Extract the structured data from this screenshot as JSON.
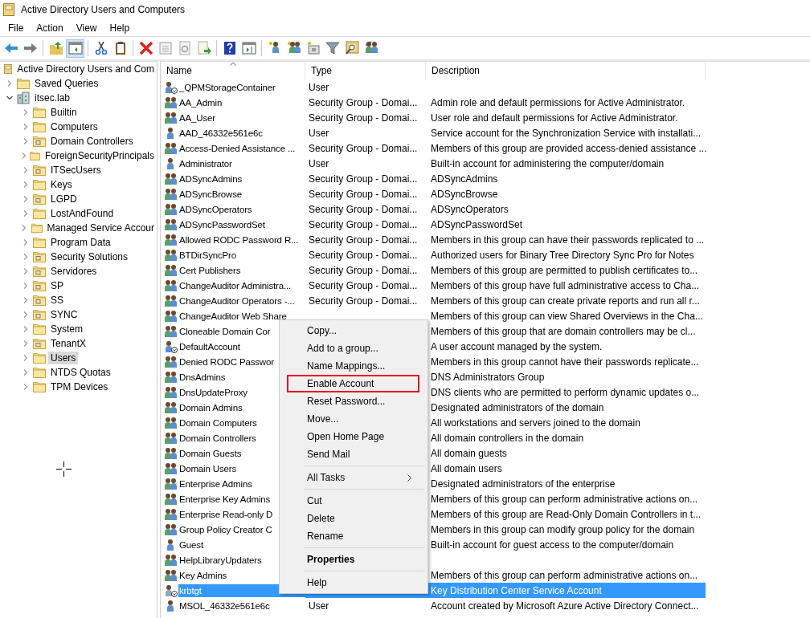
{
  "window": {
    "title": "Active Directory Users and Computers"
  },
  "menu": [
    "File",
    "Action",
    "View",
    "Help"
  ],
  "toolbar": [
    {
      "kind": "back",
      "pressed": false
    },
    {
      "kind": "forward",
      "pressed": false
    },
    {
      "kind": "sep"
    },
    {
      "kind": "up",
      "pressed": false
    },
    {
      "kind": "console-tree",
      "pressed": true
    },
    {
      "kind": "sep"
    },
    {
      "kind": "cut",
      "pressed": false
    },
    {
      "kind": "paste",
      "pressed": false
    },
    {
      "kind": "sep"
    },
    {
      "kind": "delete",
      "pressed": false
    },
    {
      "kind": "properties",
      "pressed": false
    },
    {
      "kind": "refresh",
      "pressed": false
    },
    {
      "kind": "export",
      "pressed": false
    },
    {
      "kind": "sep"
    },
    {
      "kind": "help",
      "pressed": false
    },
    {
      "kind": "action-pane",
      "pressed": false
    },
    {
      "kind": "sep"
    },
    {
      "kind": "new-user",
      "pressed": false
    },
    {
      "kind": "new-group",
      "pressed": false
    },
    {
      "kind": "new-ou",
      "pressed": false
    },
    {
      "kind": "filter",
      "pressed": false
    },
    {
      "kind": "find",
      "pressed": false
    },
    {
      "kind": "add-to-group",
      "pressed": false
    }
  ],
  "tree": {
    "label": "Active Directory Users and Com",
    "kind": "root",
    "children": [
      {
        "label": "Saved Queries",
        "kind": "container",
        "expanded": false,
        "selected": false
      },
      {
        "label": "itsec.lab",
        "kind": "domain",
        "expanded": true,
        "selected": false,
        "children": [
          {
            "label": "Builtin",
            "kind": "container",
            "expanded": false,
            "selected": false
          },
          {
            "label": "Computers",
            "kind": "container",
            "expanded": false,
            "selected": false
          },
          {
            "label": "Domain Controllers",
            "kind": "ou",
            "expanded": false,
            "selected": false
          },
          {
            "label": "ForeignSecurityPrincipals",
            "kind": "container",
            "expanded": false,
            "selected": false
          },
          {
            "label": "ITSecUsers",
            "kind": "ou",
            "expanded": false,
            "selected": false
          },
          {
            "label": "Keys",
            "kind": "container",
            "expanded": false,
            "selected": false
          },
          {
            "label": "LGPD",
            "kind": "ou",
            "expanded": false,
            "selected": false
          },
          {
            "label": "LostAndFound",
            "kind": "container",
            "expanded": false,
            "selected": false
          },
          {
            "label": "Managed Service Accour",
            "kind": "container",
            "expanded": false,
            "selected": false
          },
          {
            "label": "Program Data",
            "kind": "container",
            "expanded": false,
            "selected": false
          },
          {
            "label": "Security Solutions",
            "kind": "ou",
            "expanded": false,
            "selected": false
          },
          {
            "label": "Servidores",
            "kind": "ou",
            "expanded": false,
            "selected": false
          },
          {
            "label": "SP",
            "kind": "ou",
            "expanded": false,
            "selected": false
          },
          {
            "label": "SS",
            "kind": "ou",
            "expanded": false,
            "selected": false
          },
          {
            "label": "SYNC",
            "kind": "ou",
            "expanded": false,
            "selected": false
          },
          {
            "label": "System",
            "kind": "container",
            "expanded": false,
            "selected": false
          },
          {
            "label": "TenantX",
            "kind": "ou",
            "expanded": false,
            "selected": false
          },
          {
            "label": "Users",
            "kind": "container",
            "expanded": false,
            "selected": true
          },
          {
            "label": "NTDS Quotas",
            "kind": "container",
            "expanded": false,
            "selected": false
          },
          {
            "label": "TPM Devices",
            "kind": "container",
            "expanded": false,
            "selected": false
          }
        ]
      }
    ]
  },
  "table": {
    "columns": [
      "Name",
      "Type",
      "Description"
    ],
    "rows": [
      {
        "kind": "disabled-user",
        "name": "_QPMStorageContainer",
        "type": "User",
        "selected": false
      },
      {
        "kind": "group",
        "name": "AA_Admin",
        "type": "Security Group - Domai...",
        "description": "Admin role and default permissions for Active Administrator.",
        "selected": false
      },
      {
        "kind": "group",
        "name": "AA_User",
        "type": "Security Group - Domai...",
        "description": "User role and default permissions for Active Administrator.",
        "selected": false
      },
      {
        "kind": "user",
        "name": "AAD_46332e561e6c",
        "type": "User",
        "description": "Service account for the Synchronization Service with installati...",
        "selected": false
      },
      {
        "kind": "group",
        "name": "Access-Denied Assistance ...",
        "type": "Security Group - Domai...",
        "description": "Members of this group are provided access-denied assistance ...",
        "selected": false
      },
      {
        "kind": "user",
        "name": "Administrator",
        "type": "User",
        "description": "Built-in account for administering the computer/domain",
        "selected": false
      },
      {
        "kind": "group",
        "name": "ADSyncAdmins",
        "type": "Security Group - Domai...",
        "description": "ADSyncAdmins",
        "selected": false
      },
      {
        "kind": "group",
        "name": "ADSyncBrowse",
        "type": "Security Group - Domai...",
        "description": "ADSyncBrowse",
        "selected": false
      },
      {
        "kind": "group",
        "name": "ADSyncOperators",
        "type": "Security Group - Domai...",
        "description": "ADSyncOperators",
        "selected": false
      },
      {
        "kind": "group",
        "name": "ADSyncPasswordSet",
        "type": "Security Group - Domai...",
        "description": "ADSyncPasswordSet",
        "selected": false
      },
      {
        "kind": "group",
        "name": "Allowed RODC Password R...",
        "type": "Security Group - Domai...",
        "description": "Members in this group can have their passwords replicated to ...",
        "selected": false
      },
      {
        "kind": "group",
        "name": "BTDirSyncPro",
        "type": "Security Group - Domai...",
        "description": "Authorized users for Binary Tree Directory Sync Pro for Notes",
        "selected": false
      },
      {
        "kind": "group",
        "name": "Cert Publishers",
        "type": "Security Group - Domai...",
        "description": "Members of this group are permitted to publish certificates to...",
        "selected": false
      },
      {
        "kind": "group",
        "name": "ChangeAuditor Administra...",
        "type": "Security Group - Domai...",
        "description": "Members of this group have full administrative access to Cha...",
        "selected": false
      },
      {
        "kind": "group",
        "name": "ChangeAuditor Operators -...",
        "type": "Security Group - Domai...",
        "description": "Members of this group can create private reports and run all r...",
        "selected": false
      },
      {
        "kind": "group",
        "name": "ChangeAuditor Web Share",
        "description": "Members of this group can view Shared Overviews in the Cha...",
        "selected": false
      },
      {
        "kind": "group",
        "name": "Cloneable Domain Cor",
        "description": "Members of this group that are domain controllers may be cl...",
        "selected": false
      },
      {
        "kind": "disabled-user",
        "name": "DefaultAccount",
        "description": "A user account managed by the system.",
        "selected": false
      },
      {
        "kind": "group",
        "name": "Denied RODC Passwor",
        "description": "Members in this group cannot have their passwords replicate...",
        "selected": false
      },
      {
        "kind": "group",
        "name": "DnsAdmins",
        "description": "DNS Administrators Group",
        "selected": false
      },
      {
        "kind": "group",
        "name": "DnsUpdateProxy",
        "description": "DNS clients who are permitted to perform dynamic updates o...",
        "selected": false
      },
      {
        "kind": "group",
        "name": "Domain Admins",
        "description": "Designated administrators of the domain",
        "selected": false
      },
      {
        "kind": "group",
        "name": "Domain Computers",
        "description": "All workstations and servers joined to the domain",
        "selected": false
      },
      {
        "kind": "group",
        "name": "Domain Controllers",
        "description": "All domain controllers in the domain",
        "selected": false
      },
      {
        "kind": "group",
        "name": "Domain Guests",
        "description": "All domain guests",
        "selected": false
      },
      {
        "kind": "group",
        "name": "Domain Users",
        "description": "All domain users",
        "selected": false
      },
      {
        "kind": "group",
        "name": "Enterprise Admins",
        "description": "Designated administrators of the enterprise",
        "selected": false
      },
      {
        "kind": "group",
        "name": "Enterprise Key Admins",
        "description": "Members of this group can perform administrative actions on...",
        "selected": false
      },
      {
        "kind": "group",
        "name": "Enterprise Read-only D",
        "description": "Members of this group are Read-Only Domain Controllers in t...",
        "selected": false
      },
      {
        "kind": "group",
        "name": "Group Policy Creator C",
        "description": "Members in this group can modify group policy for the domain",
        "selected": false
      },
      {
        "kind": "user",
        "name": "Guest",
        "description": "Built-in account for guest access to the computer/domain",
        "selected": false
      },
      {
        "kind": "group",
        "name": "HelpLibraryUpdaters",
        "selected": false
      },
      {
        "kind": "group",
        "name": "Key Admins",
        "description": "Members of this group can perform administrative actions on...",
        "selected": false
      },
      {
        "kind": "disabled-user",
        "name": "krbtgt",
        "description": "Key Distribution Center Service Account",
        "selected": true
      },
      {
        "kind": "user",
        "name": "MSOL_46332e561e6c",
        "type": "User",
        "description": "Account created by Microsoft Azure Active Directory Connect...",
        "selected": false
      }
    ]
  },
  "context_menu": {
    "groups": [
      [
        {
          "label": "Copy...",
          "kind": "plain",
          "outlined": false
        },
        {
          "label": "Add to a group...",
          "kind": "plain",
          "outlined": false
        },
        {
          "label": "Name Mappings...",
          "kind": "plain",
          "outlined": false
        },
        {
          "label": "Enable Account",
          "kind": "plain",
          "outlined": true
        },
        {
          "label": "Reset Password...",
          "kind": "plain",
          "outlined": false
        },
        {
          "label": "Move...",
          "kind": "plain",
          "outlined": false
        },
        {
          "label": "Open Home Page",
          "kind": "plain",
          "outlined": false
        },
        {
          "label": "Send Mail",
          "kind": "plain",
          "outlined": false
        }
      ],
      [
        {
          "label": "All Tasks",
          "kind": "submenu",
          "outlined": false
        }
      ],
      [
        {
          "label": "Cut",
          "kind": "plain",
          "outlined": false
        },
        {
          "label": "Delete",
          "kind": "plain",
          "outlined": false
        },
        {
          "label": "Rename",
          "kind": "plain",
          "outlined": false
        }
      ],
      [
        {
          "label": "Properties",
          "kind": "default",
          "outlined": false
        }
      ],
      [
        {
          "label": "Help",
          "kind": "plain",
          "outlined": false
        }
      ]
    ]
  }
}
